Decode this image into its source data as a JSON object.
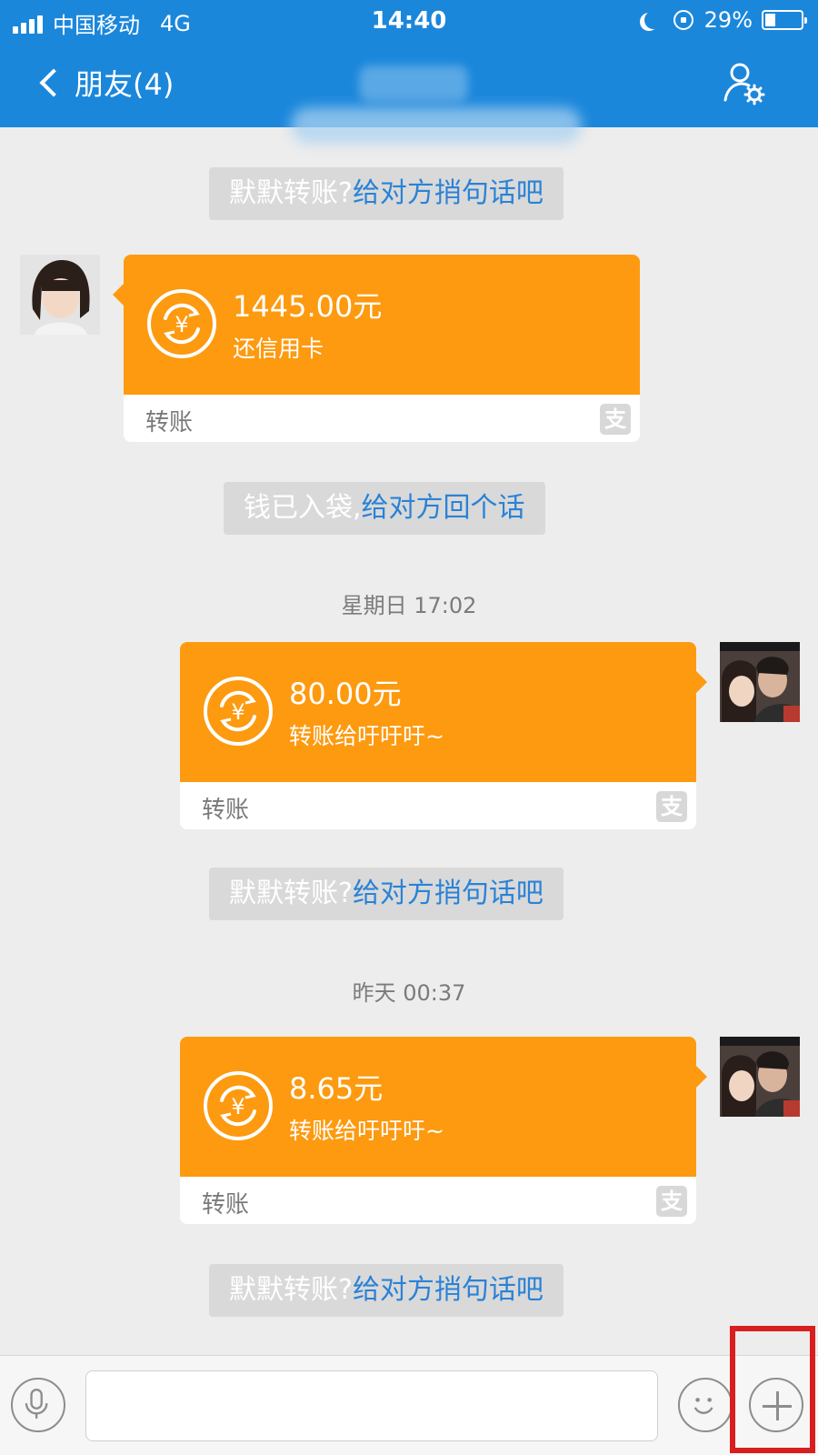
{
  "status_bar": {
    "carrier": "中国移动",
    "network": "4G",
    "time": "14:40",
    "battery_text": "29%",
    "battery_level": 0.29
  },
  "nav": {
    "back_label": "朋友(4)",
    "settings_icon": "user-settings-icon"
  },
  "messages": {
    "tip1": {
      "grey": "默默转账?",
      "link": "给对方捎句话吧"
    },
    "transfer1": {
      "amount": "1445.00元",
      "memo": "还信用卡",
      "kind": "转账",
      "badge": "支"
    },
    "tip2": {
      "grey": "钱已入袋,",
      "link": "给对方回个话"
    },
    "time1": "星期日 17:02",
    "transfer2": {
      "amount": "80.00元",
      "memo": "转账给吁吁吁~",
      "kind": "转账",
      "badge": "支"
    },
    "tip3": {
      "grey": "默默转账?",
      "link": "给对方捎句话吧"
    },
    "time2": "昨天 00:37",
    "transfer3": {
      "amount": "8.65元",
      "memo": "转账给吁吁吁~",
      "kind": "转账",
      "badge": "支"
    },
    "tip4": {
      "grey": "默默转账?",
      "link": "给对方捎句话吧"
    }
  },
  "input_bar": {
    "mic_icon": "microphone-icon",
    "emoji_icon": "smiley-icon",
    "plus_icon": "plus-icon",
    "placeholder": ""
  },
  "colors": {
    "header": "#1b87db",
    "transfer_orange": "#fd9a10",
    "link_blue": "#2a82d6",
    "highlight_red": "#d81e1e"
  }
}
